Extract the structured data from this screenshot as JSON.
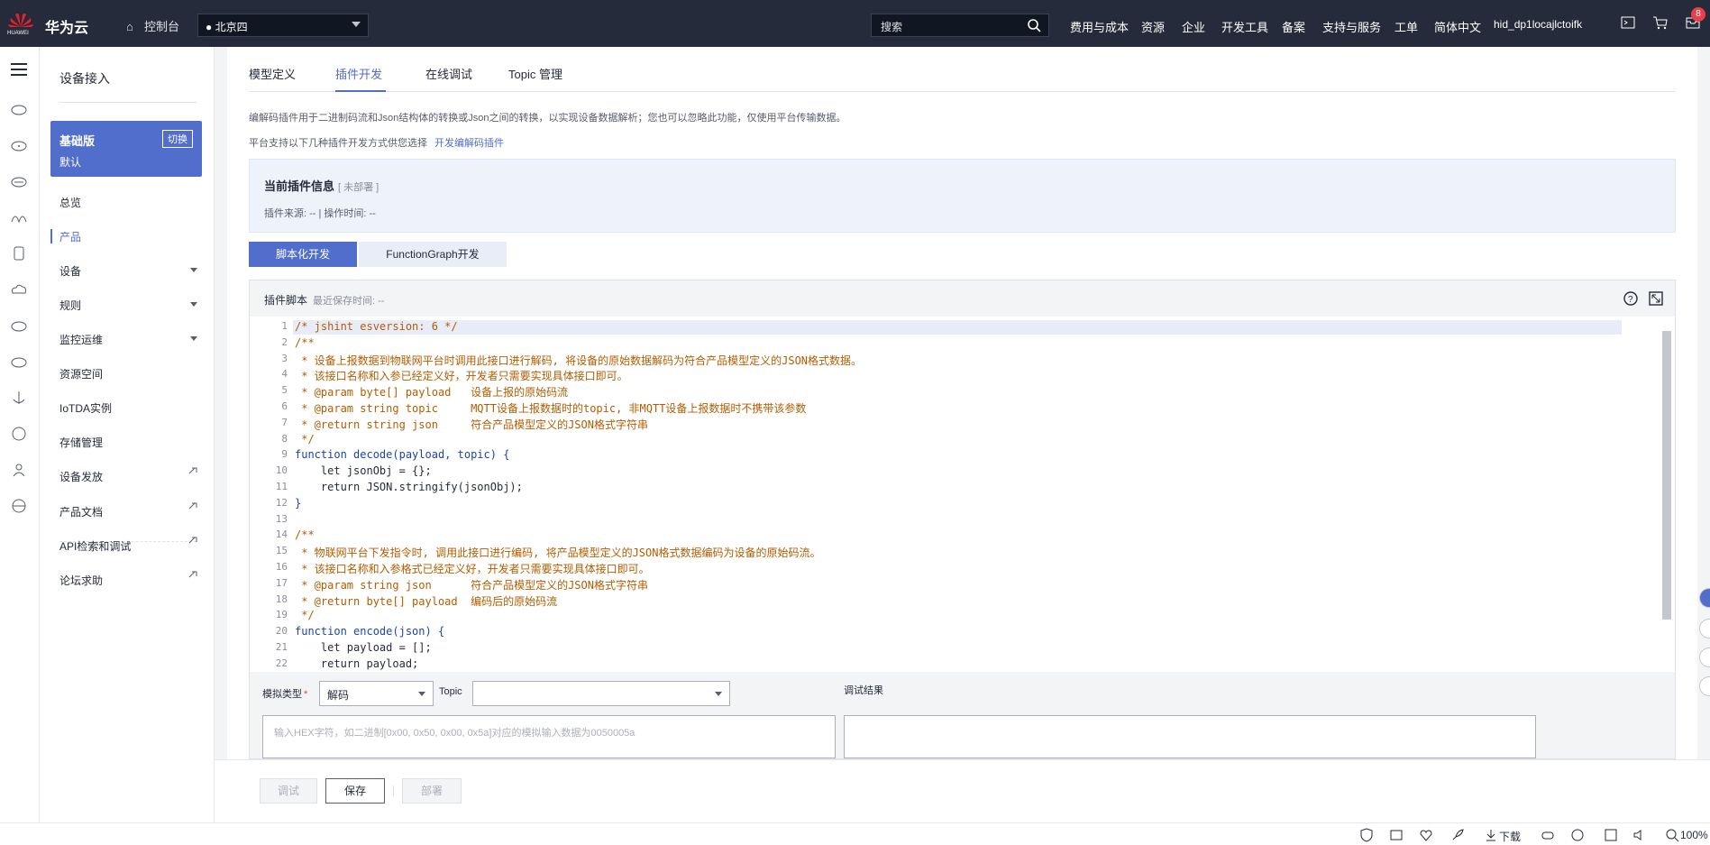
{
  "header": {
    "brand": "华为云",
    "console": "控制台",
    "region": "北京四",
    "search_placeholder": "搜索",
    "nav": [
      "费用与成本",
      "资源",
      "企业",
      "开发工具",
      "备案",
      "支持与服务",
      "工单",
      "简体中文"
    ],
    "user": "hid_dp1locajlctoifk",
    "badge_count": "8",
    "huawei_text": "HUAWEI"
  },
  "sidebar": {
    "title": "设备接入",
    "edition": {
      "name": "基础版",
      "sub": "默认",
      "switch": "切换"
    },
    "items": [
      {
        "label": "总览"
      },
      {
        "label": "产品"
      },
      {
        "label": "设备"
      },
      {
        "label": "规则"
      },
      {
        "label": "监控运维"
      },
      {
        "label": "资源空间"
      },
      {
        "label": "IoTDA实例"
      },
      {
        "label": "存储管理"
      },
      {
        "label": "设备发放"
      },
      {
        "label": "产品文档"
      },
      {
        "label": "API检索和调试"
      },
      {
        "label": "论坛求助"
      }
    ]
  },
  "tabs": [
    "模型定义",
    "插件开发",
    "在线调试",
    "Topic 管理"
  ],
  "description": {
    "line1": "编解码插件用于二进制码流和Json结构体的转换或Json之间的转换，以实现设备数据解析；您也可以忽略此功能，仅使用平台传输数据。",
    "line2": "平台支持以下几种插件开发方式供您选择",
    "link": "开发编解码插件"
  },
  "plugin_info": {
    "title": "当前插件信息",
    "status": "[ 未部署 ]",
    "meta": "插件来源: --  |  操作时间: --"
  },
  "dev_modes": [
    "脚本化开发",
    "FunctionGraph开发"
  ],
  "script": {
    "title": "插件脚本",
    "saved": "最近保存时间: --",
    "lines": [
      {
        "n": "1",
        "t": "/* jshint esversion: 6 */",
        "k": "c"
      },
      {
        "n": "2",
        "t": "/**",
        "k": "c"
      },
      {
        "n": "3",
        "t": " * 设备上报数据到物联网平台时调用此接口进行解码, 将设备的原始数据解码为符合产品模型定义的JSON格式数据。",
        "k": "c"
      },
      {
        "n": "4",
        "t": " * 该接口名称和入参已经定义好，开发者只需要实现具体接口即可。",
        "k": "c"
      },
      {
        "n": "5",
        "t": " * @param byte[] payload   设备上报的原始码流",
        "k": "c"
      },
      {
        "n": "6",
        "t": " * @param string topic     MQTT设备上报数据时的topic, 非MQTT设备上报数据时不携带该参数",
        "k": "c"
      },
      {
        "n": "7",
        "t": " * @return string json     符合产品模型定义的JSON格式字符串",
        "k": "c"
      },
      {
        "n": "8",
        "t": " */",
        "k": "c"
      },
      {
        "n": "9",
        "t": "function decode(payload, topic) {",
        "k": "kw"
      },
      {
        "n": "10",
        "t": "    let jsonObj = {};",
        "k": "n"
      },
      {
        "n": "11",
        "t": "    return JSON.stringify(jsonObj);",
        "k": "n"
      },
      {
        "n": "12",
        "t": "}",
        "k": "kw"
      },
      {
        "n": "13",
        "t": "",
        "k": "n"
      },
      {
        "n": "14",
        "t": "/**",
        "k": "c"
      },
      {
        "n": "15",
        "t": " * 物联网平台下发指令时, 调用此接口进行编码, 将产品模型定义的JSON格式数据编码为设备的原始码流。",
        "k": "c"
      },
      {
        "n": "16",
        "t": " * 该接口名称和入参格式已经定义好，开发者只需要实现具体接口即可。",
        "k": "c"
      },
      {
        "n": "17",
        "t": " * @param string json      符合产品模型定义的JSON格式字符串",
        "k": "c"
      },
      {
        "n": "18",
        "t": " * @return byte[] payload  编码后的原始码流",
        "k": "c"
      },
      {
        "n": "19",
        "t": " */",
        "k": "c"
      },
      {
        "n": "20",
        "t": "function encode(json) {",
        "k": "kw"
      },
      {
        "n": "21",
        "t": "    let payload = [];",
        "k": "n"
      },
      {
        "n": "22",
        "t": "    return payload;",
        "k": "n"
      }
    ]
  },
  "debug": {
    "sim_type_label": "模拟类型",
    "sim_type_value": "解码",
    "topic_label": "Topic",
    "topic_value": "",
    "result_label": "调试结果",
    "input_placeholder": "输入HEX字符，如二进制[0x00, 0x50, 0x00, 0x5a]对应的模拟输入数据为0050005a"
  },
  "footer": {
    "debug": "调试",
    "save": "保存",
    "deploy": "部署"
  },
  "statusbar": {
    "download": "下载",
    "zoom": "100%"
  }
}
